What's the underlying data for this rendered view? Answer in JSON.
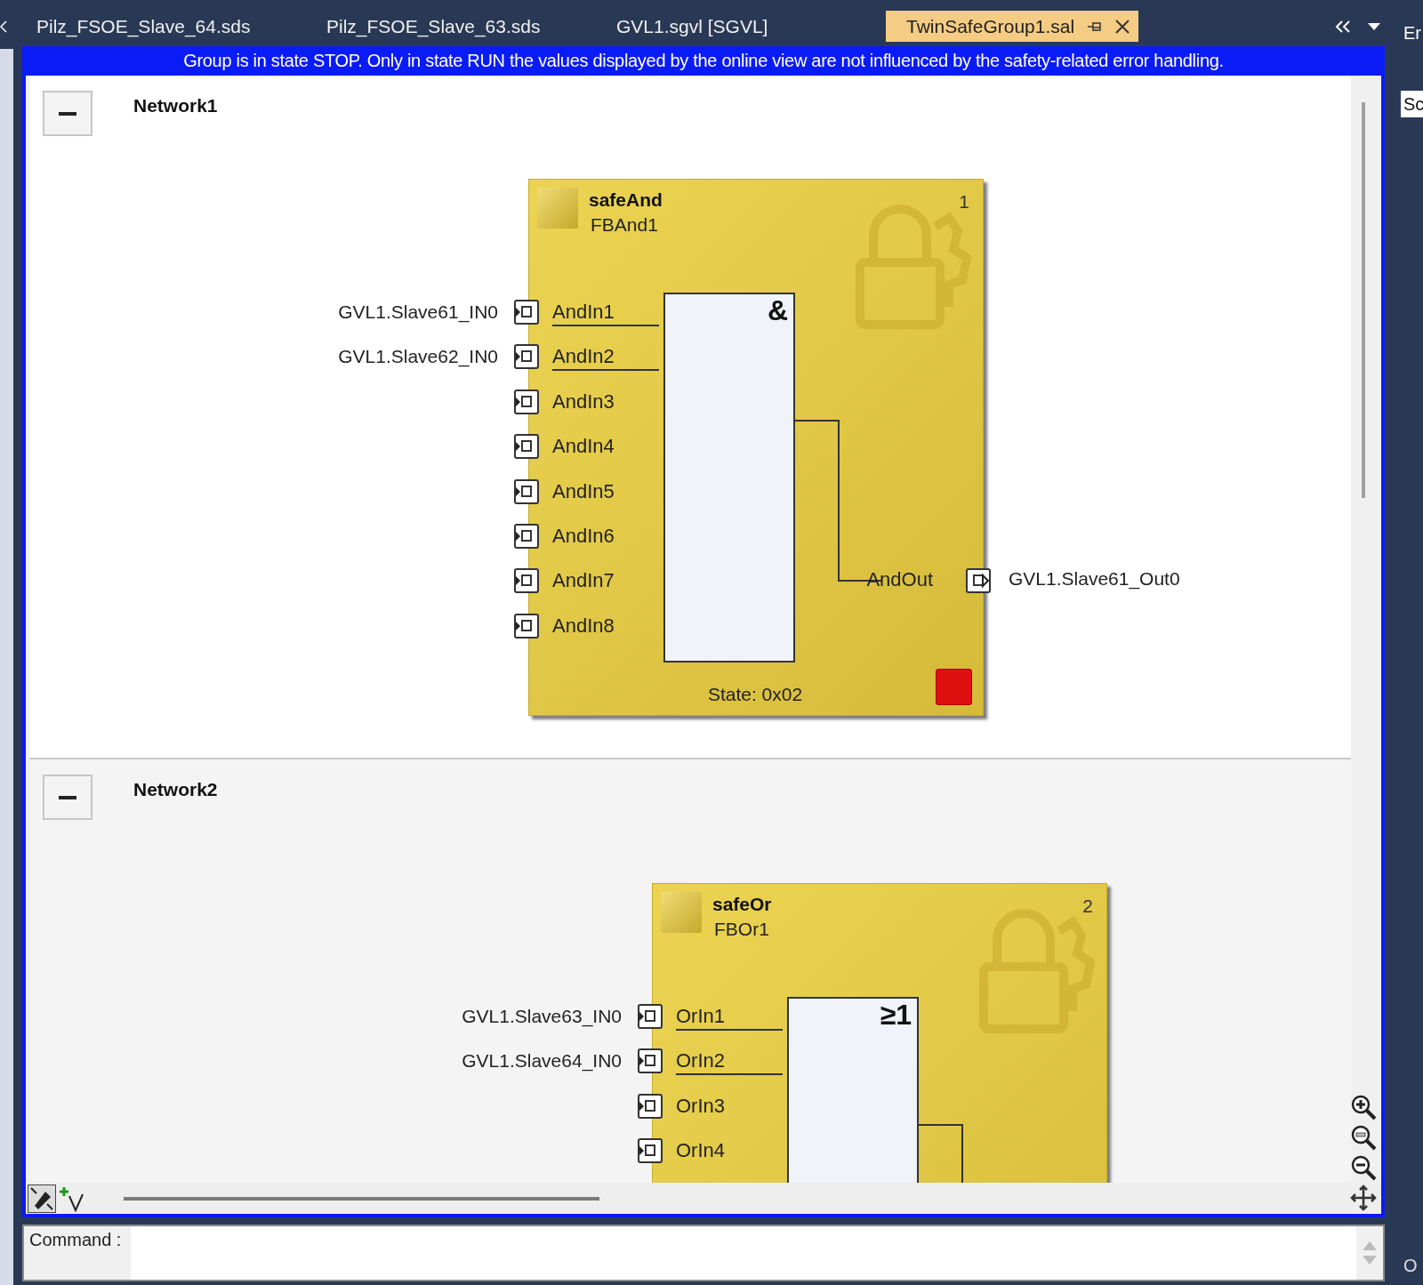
{
  "tabs": [
    {
      "label": "Pilz_FSOE_Slave_64.sds",
      "selected": false
    },
    {
      "label": "Pilz_FSOE_Slave_63.sds",
      "selected": false
    },
    {
      "label": "GVL1.sgvl [SGVL]",
      "selected": false
    },
    {
      "label": "TwinSafeGroup1.sal",
      "selected": true
    }
  ],
  "info_bar": "Group is in state STOP. Only in state RUN the values displayed by the online view are not influenced by the safety-related error handling.",
  "networks": [
    {
      "title": "Network1",
      "expanded": true,
      "blocks": [
        {
          "type": "safeAnd",
          "name": "FBAnd1",
          "number": "1",
          "symbol": "&",
          "error": true,
          "state": "State: 0x02",
          "inputs": [
            {
              "pin": "AndIn1",
              "variable": "GVL1.Slave61_IN0"
            },
            {
              "pin": "AndIn2",
              "variable": "GVL1.Slave62_IN0"
            },
            {
              "pin": "AndIn3"
            },
            {
              "pin": "AndIn4"
            },
            {
              "pin": "AndIn5"
            },
            {
              "pin": "AndIn6"
            },
            {
              "pin": "AndIn7"
            },
            {
              "pin": "AndIn8"
            }
          ],
          "output": {
            "pin": "AndOut",
            "variable": "GVL1.Slave61_Out0"
          }
        }
      ]
    },
    {
      "title": "Network2",
      "expanded": true,
      "blocks": [
        {
          "type": "safeOr",
          "name": "FBOr1",
          "number": "2",
          "symbol": "≥1",
          "inputs": [
            {
              "pin": "OrIn1",
              "variable": "GVL1.Slave63_IN0"
            },
            {
              "pin": "OrIn2",
              "variable": "GVL1.Slave64_IN0"
            },
            {
              "pin": "OrIn3"
            },
            {
              "pin": "OrIn4"
            }
          ]
        }
      ]
    }
  ],
  "command": {
    "label": "Command :"
  },
  "right_panel": {
    "top": "Er",
    "middle": "Sc",
    "bottom": "O"
  }
}
